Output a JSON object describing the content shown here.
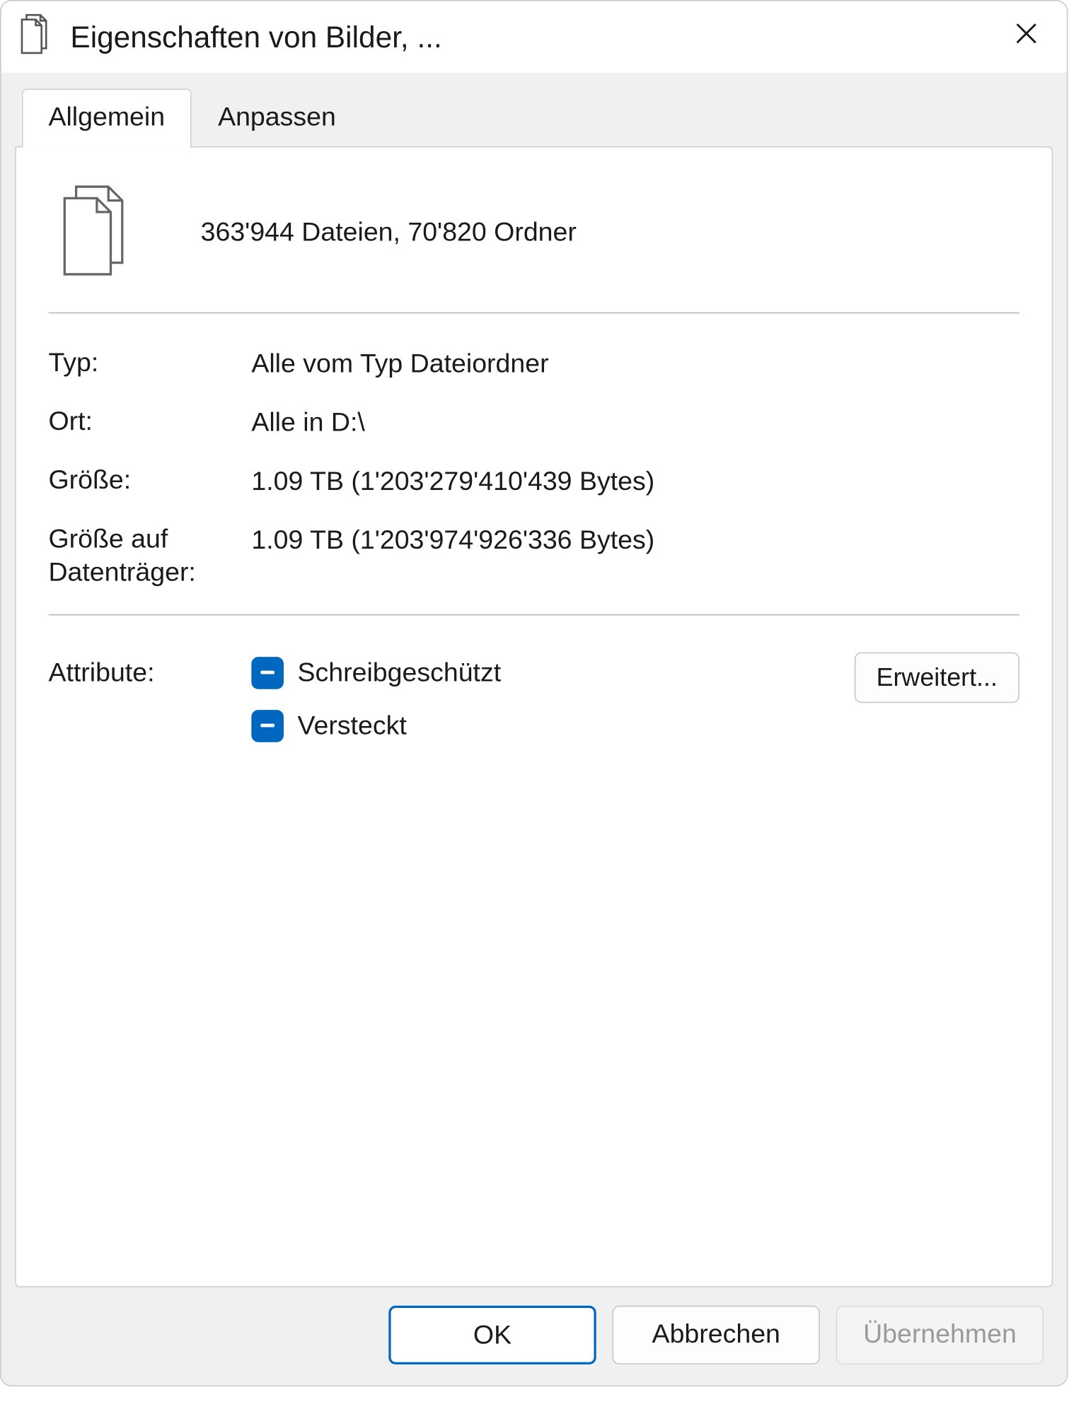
{
  "window": {
    "title": "Eigenschaften von Bilder, ..."
  },
  "tabs": {
    "general": "Allgemein",
    "customize": "Anpassen"
  },
  "summary": "363'944 Dateien, 70'820 Ordner",
  "props": {
    "type_label": "Typ:",
    "type_value": "Alle vom Typ Dateiordner",
    "location_label": "Ort:",
    "location_value": "Alle in D:\\",
    "size_label": "Größe:",
    "size_value": "1.09 TB (1'203'279'410'439 Bytes)",
    "size_on_disk_label": "Größe auf Datenträger:",
    "size_on_disk_value": "1.09 TB (1'203'974'926'336 Bytes)"
  },
  "attributes": {
    "label": "Attribute:",
    "readonly": "Schreibgeschützt",
    "hidden": "Versteckt",
    "advanced_button": "Erweitert..."
  },
  "footer": {
    "ok": "OK",
    "cancel": "Abbrechen",
    "apply": "Übernehmen"
  }
}
